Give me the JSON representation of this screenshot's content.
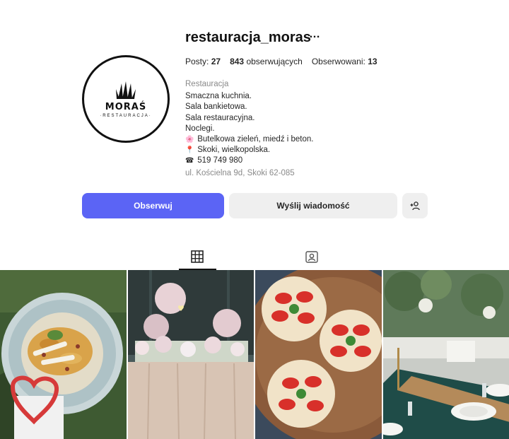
{
  "profile": {
    "username": "restauracja_moras",
    "more_icon": "…",
    "avatar": {
      "brand": "MORAŚ",
      "sub": "·RESTAURACJA·"
    }
  },
  "stats": {
    "posts_label": "Posty:",
    "posts_value": "27",
    "followers_value": "843",
    "followers_label": "obserwujących",
    "following_label": "Obserwowani:",
    "following_value": "13"
  },
  "bio": {
    "category": "Restauracja",
    "lines": [
      "Smaczna kuchnia.",
      "Sala bankietowa.",
      "Sala restauracyjna.",
      "Noclegi."
    ],
    "flower_line": "Butelkowa zieleń, miedź i beton.",
    "location_line": "Skoki, wielkopolska.",
    "phone_line": "519 749 980",
    "address": "ul. Kościelna 9d, Skoki 62-085"
  },
  "actions": {
    "follow_label": "Obserwuj",
    "message_label": "Wyślij wiadomość",
    "add_user_icon": "+👤"
  },
  "tabs": {
    "active": "grid"
  },
  "posts": [
    {
      "name": "pasta-dish"
    },
    {
      "name": "wedding-flower-table"
    },
    {
      "name": "strawberry-tarts"
    },
    {
      "name": "banquet-hall-table"
    }
  ],
  "colors": {
    "accent": "#5b64f5",
    "secondary_button": "#efefef",
    "muted_text": "#8a8a8a"
  }
}
